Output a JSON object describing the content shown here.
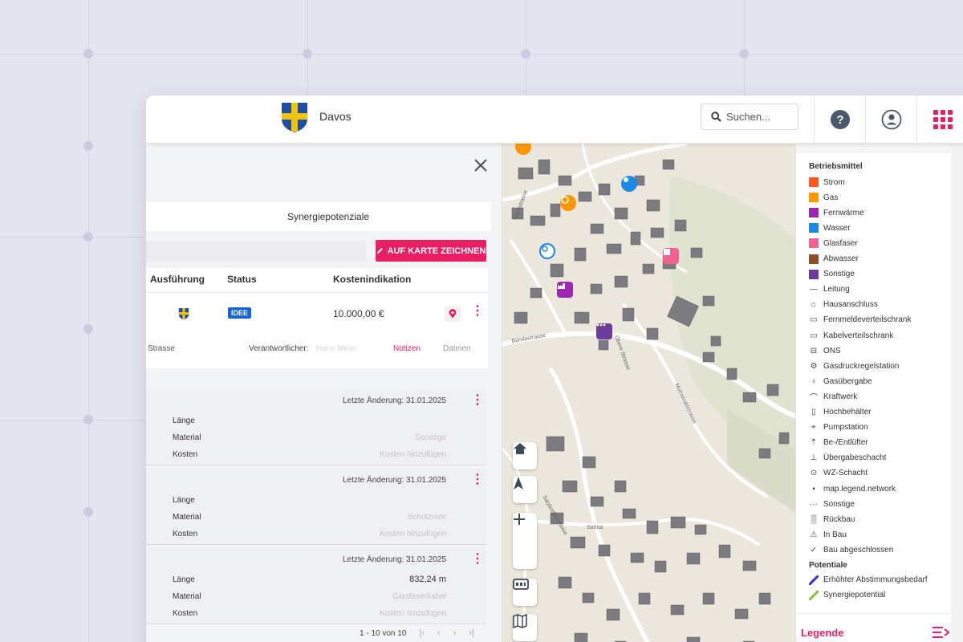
{
  "header": {
    "title": "Davos",
    "search_placeholder": "Suchen..."
  },
  "panel": {
    "tab_label": "Synergiepotenziale",
    "draw_button": "AUF KARTE ZEICHNEN",
    "columns": [
      "Ausführung",
      "Status",
      "Kostenindikation"
    ],
    "row": {
      "status_badge": "IDEE",
      "cost": "10.000,00 €",
      "location": "Strasse",
      "responsible_label": "Verantwortlicher:",
      "responsible_value": "Hans Meier",
      "notes_link": "Notizen",
      "files_link": "Dateien"
    },
    "cards": [
      {
        "date": "Letzte Änderung: 31.01.2025",
        "laenge_label": "Länge",
        "material_label": "Material",
        "kosten_label": "Kosten",
        "laenge_value": "",
        "material_value": "Sonstige",
        "kosten_value": "Kosten hinzufügen"
      },
      {
        "date": "Letzte Änderung: 31.01.2025",
        "laenge_label": "Länge",
        "material_label": "Material",
        "kosten_label": "Kosten",
        "laenge_value": "",
        "material_value": "Schutzrohr",
        "kosten_value": "Kosten hinzufügen"
      },
      {
        "date": "Letzte Änderung: 31.01.2025",
        "laenge_label": "Länge",
        "material_label": "Material",
        "kosten_label": "Kosten",
        "laenge_value": "832,24 m",
        "material_value": "Glasfaserkabel",
        "kosten_value": "Kosten hinzufügen"
      }
    ],
    "pager": "1 - 10 von 10"
  },
  "map": {
    "street_labels": [
      "Kirchstrasse",
      "Obere Strasse",
      "Bündastrasse",
      "Matta­waldstrasse",
      "Salzbodenstrasse",
      "Sonna"
    ]
  },
  "legend": {
    "section_betriebsmittel": "Betriebsmittel",
    "items": [
      {
        "label": "Strom",
        "color": "#ff5722",
        "kind": "square"
      },
      {
        "label": "Gas",
        "color": "#ff9800",
        "kind": "square"
      },
      {
        "label": "Fernwärme",
        "color": "#9c27b0",
        "kind": "square"
      },
      {
        "label": "Wasser",
        "color": "#1e88e5",
        "kind": "square"
      },
      {
        "label": "Glasfaser",
        "color": "#f06292",
        "kind": "square"
      },
      {
        "label": "Abwasser",
        "color": "#8d4f2a",
        "kind": "square"
      },
      {
        "label": "Sonstige",
        "color": "#6a3d9a",
        "kind": "square"
      },
      {
        "label": "Leitung",
        "icon": "line-icon"
      },
      {
        "label": "Hausanschluss",
        "icon": "house-icon"
      },
      {
        "label": "Fernmeldeverteilschrank",
        "icon": "cabinet-icon"
      },
      {
        "label": "Kabelverteilschrank",
        "icon": "cabinet-icon"
      },
      {
        "label": "ONS",
        "icon": "ons-icon"
      },
      {
        "label": "Gasdruckregelstation",
        "icon": "regulator-icon"
      },
      {
        "label": "Gasübergabe",
        "icon": "transfer-icon"
      },
      {
        "label": "Kraftwerk",
        "icon": "plant-icon"
      },
      {
        "label": "Hochbehälter",
        "icon": "tank-icon"
      },
      {
        "label": "Pumpstation",
        "icon": "pump-icon"
      },
      {
        "label": "Be-/Entlüfter",
        "icon": "vent-icon"
      },
      {
        "label": "Übergabeschacht",
        "icon": "shaft-icon"
      },
      {
        "label": "WZ-Schacht",
        "icon": "wz-icon"
      },
      {
        "label": "map.legend.network",
        "icon": "network-icon"
      },
      {
        "label": "Sonstige",
        "icon": "dots-icon"
      },
      {
        "label": "Rückbau",
        "icon": "hatch-icon"
      },
      {
        "label": "In Bau",
        "icon": "construction-icon"
      },
      {
        "label": "Bau abgeschlossen",
        "icon": "done-icon"
      }
    ],
    "section_potentiale": "Potentiale",
    "potentiale": [
      {
        "label": "Erhöhter Abstimmungsbedarf",
        "color": "#3f3dbf"
      },
      {
        "label": "Synergiepotential",
        "color": "#8bc34a"
      }
    ],
    "footer_label": "Legende"
  },
  "colors": {
    "accent": "#e91e63",
    "badge": "#1565d8"
  }
}
